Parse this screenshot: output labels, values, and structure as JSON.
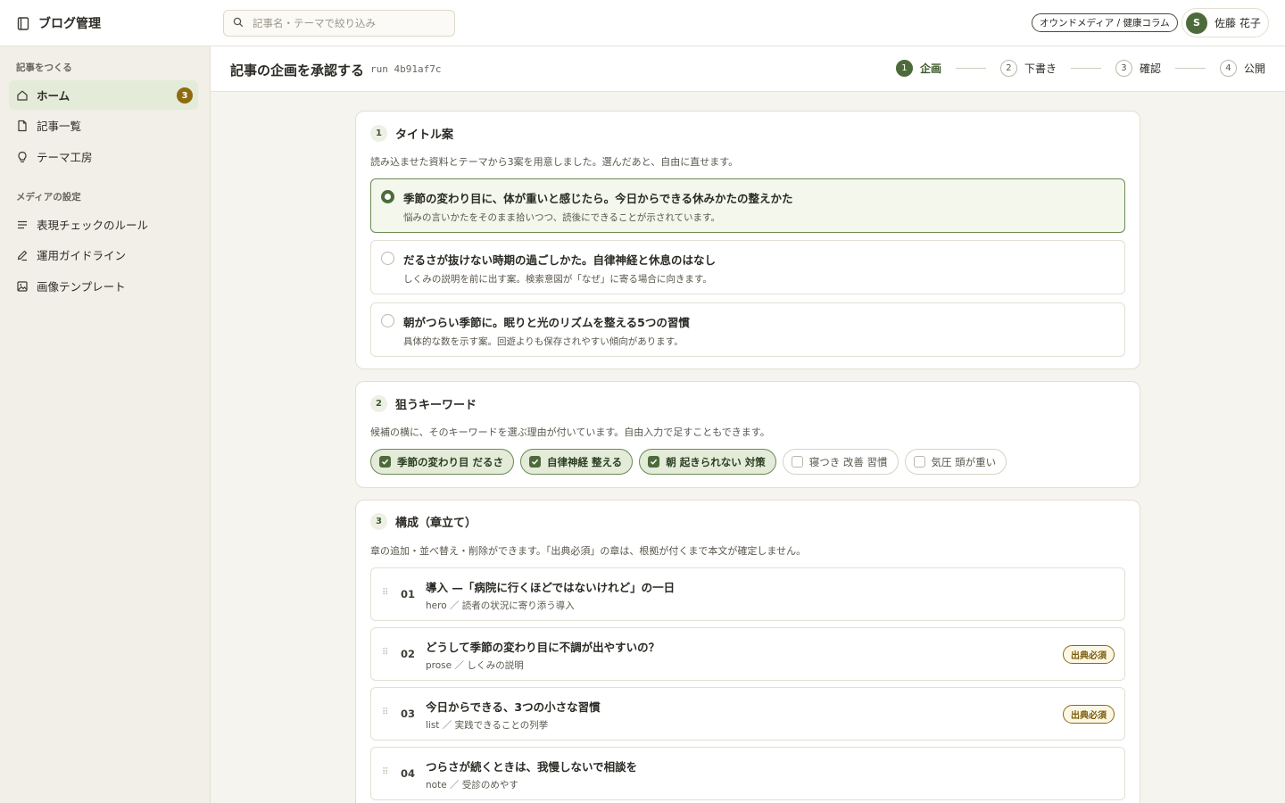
{
  "app": {
    "title": "ブログ管理"
  },
  "search": {
    "placeholder": "記事名・テーマで絞り込み",
    "value": ""
  },
  "header": {
    "media": "オウンドメディア / 健康コラム",
    "user_initial": "S",
    "user_name": "佐藤 花子"
  },
  "sidebar": {
    "section1": "記事をつくる",
    "nav1": [
      {
        "label": "ホーム",
        "icon": "home-icon",
        "badge": "3",
        "active": true
      },
      {
        "label": "記事一覧",
        "icon": "document-icon"
      },
      {
        "label": "テーマ工房",
        "icon": "lightbulb-icon"
      }
    ],
    "section2": "メディアの設定",
    "nav2": [
      {
        "label": "表現チェックのルール",
        "icon": "list-icon"
      },
      {
        "label": "運用ガイドライン",
        "icon": "pen-icon"
      },
      {
        "label": "画像テンプレート",
        "icon": "image-icon"
      }
    ]
  },
  "page": {
    "title": "記事の企画を承認する",
    "run": "run 4b91af7c"
  },
  "stepper": [
    {
      "num": "1",
      "label": "企画",
      "current": true
    },
    {
      "num": "2",
      "label": "下書き"
    },
    {
      "num": "3",
      "label": "確認"
    },
    {
      "num": "4",
      "label": "公開"
    }
  ],
  "titles": {
    "num": "1",
    "heading": "タイトル案",
    "desc": "読み込ませた資料とテーマから3案を用意しました。選んだあと、自由に直せます。",
    "options": [
      {
        "title": "季節の変わり目に、体が重いと感じたら。今日からできる休みかたの整えかた",
        "sub": "悩みの言いかたをそのまま拾いつつ、読後にできることが示されています。",
        "selected": true
      },
      {
        "title": "だるさが抜けない時期の過ごしかた。自律神経と休息のはなし",
        "sub": "しくみの説明を前に出す案。検索意図が「なぜ」に寄る場合に向きます。"
      },
      {
        "title": "朝がつらい季節に。眠りと光のリズムを整える5つの習慣",
        "sub": "具体的な数を示す案。回遊よりも保存されやすい傾向があります。"
      }
    ]
  },
  "keywords": {
    "num": "2",
    "heading": "狙うキーワード",
    "desc": "候補の横に、そのキーワードを選ぶ理由が付いています。自由入力で足すこともできます。",
    "items": [
      {
        "label": "季節の変わり目 だるさ",
        "checked": true
      },
      {
        "label": "自律神経 整える",
        "checked": true
      },
      {
        "label": "朝 起きられない 対策",
        "checked": true
      },
      {
        "label": "寝つき 改善 習慣",
        "checked": false
      },
      {
        "label": "気圧 頭が重い",
        "checked": false
      }
    ]
  },
  "outline": {
    "num": "3",
    "heading": "構成（章立て）",
    "desc": "章の追加・並べ替え・削除ができます。「出典必須」の章は、根拠が付くまで本文が確定しません。",
    "required_label": "出典必須",
    "chapters": [
      {
        "num": "01",
        "title": "導入 —「病院に行くほどではないけれど」の一日",
        "sub": "hero ／ 読者の状況に寄り添う導入",
        "required": false
      },
      {
        "num": "02",
        "title": "どうして季節の変わり目に不調が出やすいの？",
        "sub": "prose ／ しくみの説明",
        "required": true
      },
      {
        "num": "03",
        "title": "今日からできる、3つの小さな習慣",
        "sub": "list ／ 実践できることの列挙",
        "required": true
      },
      {
        "num": "04",
        "title": "つらさが続くときは、我慢しないで相談を",
        "sub": "note ／ 受診のめやす",
        "required": false
      }
    ]
  },
  "colors": {
    "accent": "#4d6b3a",
    "badge": "#8e6b10",
    "background": "#f6f4ee"
  }
}
